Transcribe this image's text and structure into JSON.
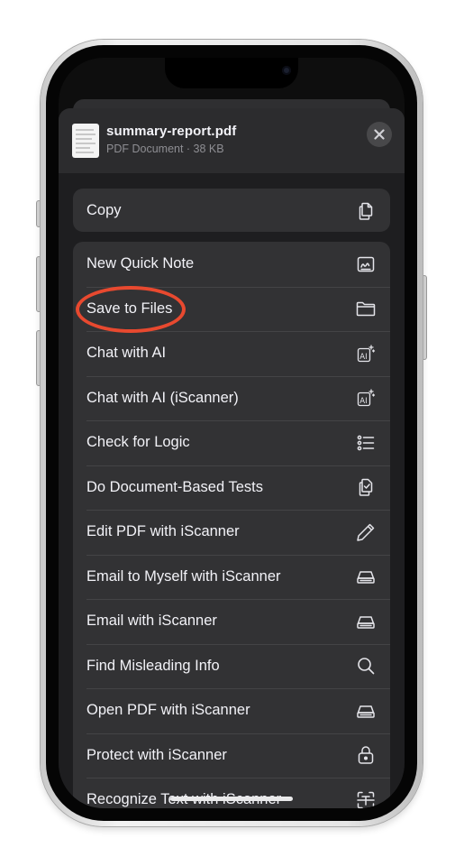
{
  "file": {
    "name": "summary-report.pdf",
    "meta": "PDF Document · 38 KB"
  },
  "header": {
    "close_icon": "xmark-icon"
  },
  "copy_group": [
    {
      "label": "Copy",
      "icon": "copy-icon"
    }
  ],
  "actions": [
    {
      "label": "New Quick Note",
      "icon": "quick-note-icon"
    },
    {
      "label": "Save to Files",
      "icon": "folder-icon"
    },
    {
      "label": "Chat with AI",
      "icon": "ai-sparkle-icon"
    },
    {
      "label": "Chat with AI (iScanner)",
      "icon": "ai-sparkle-icon"
    },
    {
      "label": "Check for Logic",
      "icon": "list-icon"
    },
    {
      "label": "Do Document-Based Tests",
      "icon": "doc-check-icon"
    },
    {
      "label": "Edit PDF with iScanner",
      "icon": "pencil-icon"
    },
    {
      "label": "Email to Myself with iScanner",
      "icon": "scanner-icon"
    },
    {
      "label": "Email with iScanner",
      "icon": "scanner-icon"
    },
    {
      "label": "Find Misleading Info",
      "icon": "magnifier-icon"
    },
    {
      "label": "Open PDF with iScanner",
      "icon": "scanner-icon"
    },
    {
      "label": "Protect with iScanner",
      "icon": "lock-icon"
    },
    {
      "label": "Recognize Text with iScanner",
      "icon": "text-recognize-icon"
    }
  ],
  "highlight": {
    "target": "Save to Files",
    "color": "#e8492f"
  }
}
